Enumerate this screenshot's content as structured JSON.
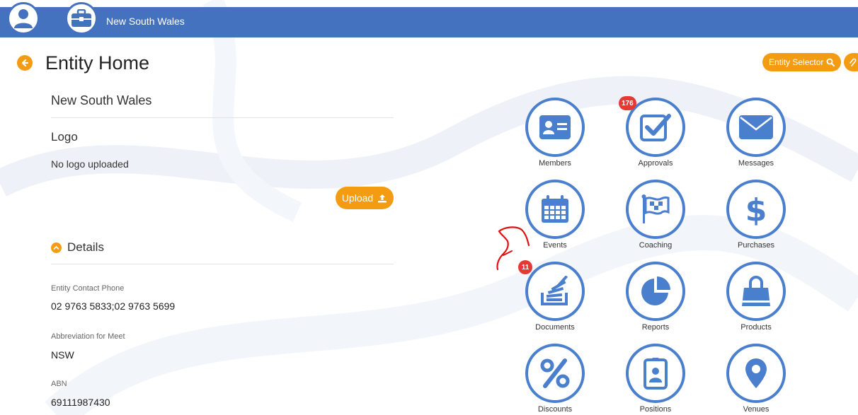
{
  "topbar": {
    "title": "New South Wales"
  },
  "header": {
    "page_title": "Entity Home",
    "entity_selector_label": "Entity Selector"
  },
  "entity": {
    "name": "New South Wales",
    "logo_heading": "Logo",
    "logo_status": "No logo uploaded",
    "upload_label": "Upload"
  },
  "details": {
    "heading": "Details",
    "fields": [
      {
        "label": "Entity Contact Phone",
        "value": "02 9763 5833;02 9763 5699"
      },
      {
        "label": "Abbreviation for Meet",
        "value": "NSW"
      },
      {
        "label": "ABN",
        "value": "69111987430"
      }
    ]
  },
  "tiles": [
    {
      "label": "Members",
      "icon": "id-card-icon"
    },
    {
      "label": "Approvals",
      "icon": "checkbox-icon",
      "badge": "176"
    },
    {
      "label": "Messages",
      "icon": "envelope-icon"
    },
    {
      "label": "Events",
      "icon": "calendar-icon"
    },
    {
      "label": "Coaching",
      "icon": "flag-icon"
    },
    {
      "label": "Purchases",
      "icon": "dollar-icon"
    },
    {
      "label": "Documents",
      "icon": "document-stack-icon",
      "badge": "11"
    },
    {
      "label": "Reports",
      "icon": "pie-chart-icon"
    },
    {
      "label": "Products",
      "icon": "shopping-bag-icon"
    },
    {
      "label": "Discounts",
      "icon": "percent-icon"
    },
    {
      "label": "Positions",
      "icon": "badge-icon"
    },
    {
      "label": "Venues",
      "icon": "map-pin-icon"
    }
  ],
  "colors": {
    "brand_blue": "#4472be",
    "accent_orange": "#f39c12",
    "badge_red": "#e53935",
    "annotation_red": "#e01010"
  }
}
